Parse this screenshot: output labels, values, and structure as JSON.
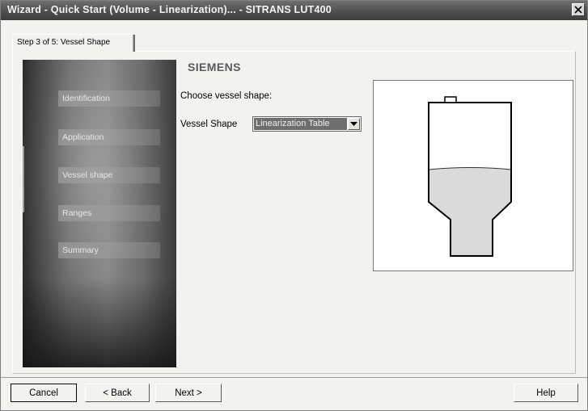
{
  "window": {
    "title": "Wizard - Quick Start (Volume - Linearization)... - SITRANS LUT400"
  },
  "tab": {
    "label": "Step 3 of 5: Vessel Shape"
  },
  "sidebar": {
    "items": [
      {
        "label": "Identification"
      },
      {
        "label": "Application"
      },
      {
        "label": "Vessel shape"
      },
      {
        "label": "Ranges"
      },
      {
        "label": "Summary"
      }
    ]
  },
  "content": {
    "brand": "SIEMENS",
    "prompt": "Choose vessel shape:",
    "vessel_shape_label": "Vessel Shape",
    "vessel_shape_value": "Linearization Table"
  },
  "footer": {
    "cancel_label": "Cancel",
    "back_label": "< Back",
    "next_label": "Next >",
    "help_label": "Help"
  },
  "colors": {
    "titlebar": "#4f4f4f",
    "liquid_fill": "#dadada",
    "selected_value_bg": "#6e6e6e"
  },
  "icons": [
    "close-icon",
    "dropdown-arrow-icon"
  ]
}
